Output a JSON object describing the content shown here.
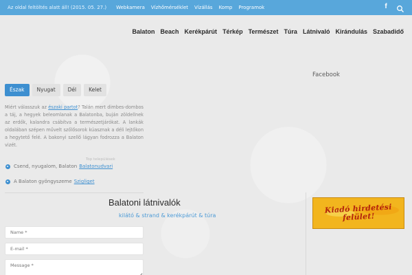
{
  "topbar": {
    "notice": "Az oldal feltöltés alatt áll! (2015. 05. 27.)",
    "links": [
      "Webkamera",
      "Vízhőmérséklet",
      "Vízállás",
      "Komp",
      "Programok"
    ],
    "facebook_glyph": "f",
    "icons": [
      "facebook-icon",
      "search-icon"
    ]
  },
  "nav": {
    "items": [
      "Balaton",
      "Beach",
      "Kerékpárút",
      "Térkép",
      "Természet",
      "Túra",
      "Látnivaló",
      "Kirándulás",
      "Szabadidő"
    ]
  },
  "tabs": [
    "Észak",
    "Nyugat",
    "Dél",
    "Kelet"
  ],
  "active_tab": "Észak",
  "intro": {
    "before_link": "Miért válasszuk az ",
    "link": "északi partot",
    "after_link": "? Talán mert dimbes-dombos a táj, a hegyek beleomlanak a Balatonba, buján zöldellnek az erdők, kalandra csábítva a természetjárókat. A lankák oldalában szépen művelt szőlősorok kúasznak a déli lejtőkon a hegytető felé. A bakonyi szellő lágyan fodrozza a Balaton vizét."
  },
  "top_settlements_label": "Top települések",
  "list": [
    {
      "text": "Csend, nyugalom, Balaton",
      "link": "Balatonudvari"
    },
    {
      "text": "A Balaton gyöngyszeme",
      "link": "Szigliget"
    }
  ],
  "section": {
    "title": "Balatoni látnivalók",
    "subtitle": "kilátó & strand & kerékpárút & túra"
  },
  "form": {
    "name_placeholder": "Name *",
    "email_placeholder": "E-mail *",
    "message_placeholder": "Message *"
  },
  "sidebar": {
    "facebook_title": "Facebook",
    "ad_text": "Kiadó hirdetési felület!"
  },
  "colors": {
    "topbar": "#58a7db",
    "accent": "#3d8fd0",
    "ad_background": "#f2b51e",
    "ad_text": "#b3230c"
  }
}
